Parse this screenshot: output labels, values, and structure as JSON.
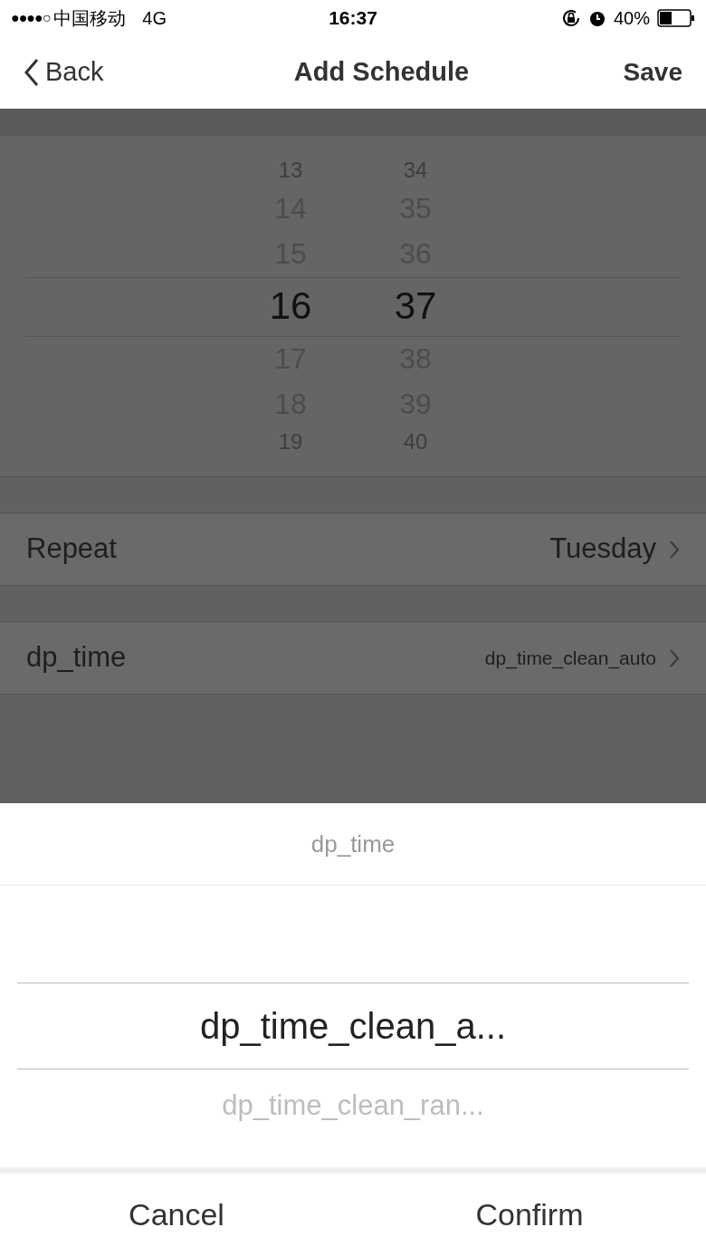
{
  "status_bar": {
    "signal": "●●●●○",
    "carrier": "中国移动",
    "network": "4G",
    "time": "16:37",
    "battery": "40%"
  },
  "nav": {
    "back": "Back",
    "title": "Add Schedule",
    "action": "Save"
  },
  "time_picker": {
    "columns": [
      {
        "items": [
          {
            "label": "13",
            "selected": false
          },
          {
            "label": "14",
            "selected": false
          },
          {
            "label": "15",
            "selected": false
          },
          {
            "label": "16",
            "selected": true
          },
          {
            "label": "17",
            "selected": false
          },
          {
            "label": "18",
            "selected": false
          },
          {
            "label": "19",
            "selected": false
          }
        ]
      },
      {
        "items": [
          {
            "label": "34",
            "selected": false
          },
          {
            "label": "35",
            "selected": false
          },
          {
            "label": "36",
            "selected": false
          },
          {
            "label": "37",
            "selected": true
          },
          {
            "label": "38",
            "selected": false
          },
          {
            "label": "39",
            "selected": false
          },
          {
            "label": "40",
            "selected": false
          }
        ]
      }
    ]
  },
  "rows": [
    {
      "label": "Repeat",
      "value": "Tuesday",
      "kind": "large"
    },
    {
      "label": "dp_time",
      "value": "dp_time_clean_auto",
      "kind": "small"
    }
  ],
  "sheet": {
    "title": "dp_time",
    "options": [
      {
        "label": "dp_time_clean_a...",
        "selected": true
      },
      {
        "label": "dp_time_clean_ran...",
        "selected": false
      }
    ],
    "buttons": [
      "Cancel",
      "Confirm"
    ]
  }
}
